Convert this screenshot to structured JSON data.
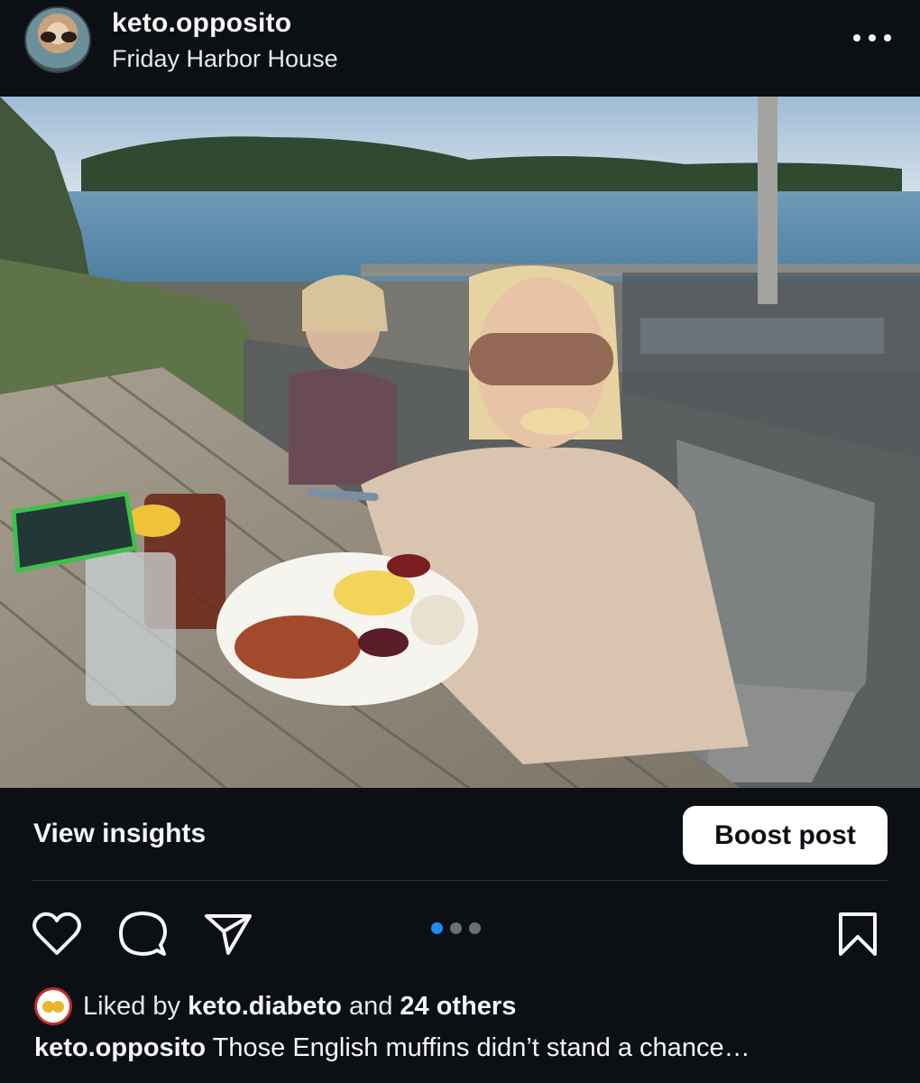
{
  "post": {
    "username": "keto.opposito",
    "location": "Friday Harbor House",
    "more_icon": "ellipsis-icon"
  },
  "actions": {
    "view_insights": "View insights",
    "boost_post": "Boost post",
    "icons": [
      "heart-icon",
      "comment-icon",
      "share-icon",
      "bookmark-icon"
    ]
  },
  "carousel": {
    "total_slides": 3,
    "current_slide": 1,
    "active_color": "#1d8cf8"
  },
  "likes": {
    "prefix": "Liked by",
    "liked_by_user": "keto.diabeto",
    "conjunction": "and",
    "others": "24 others"
  },
  "caption": {
    "username": "keto.opposito",
    "text": "Those English muffins didn’t stand a chance…"
  },
  "colors": {
    "background": "#0c1014",
    "button_bg": "#ffffff",
    "text": "#f5f5f5"
  }
}
